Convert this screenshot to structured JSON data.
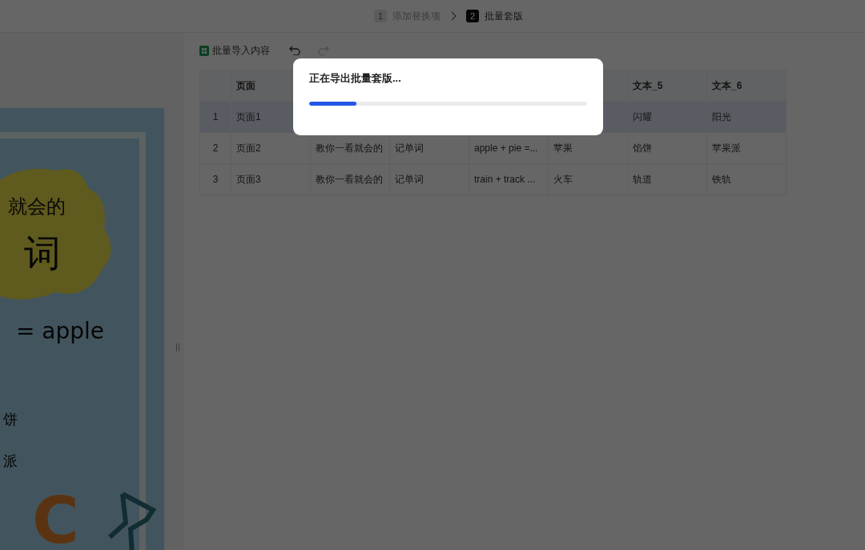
{
  "steps": [
    {
      "number": "1",
      "label": "添加替换项",
      "selected": false
    },
    {
      "number": "2",
      "label": "批量套版",
      "selected": true
    }
  ],
  "preview": {
    "texts": [
      {
        "kind": "subtitle",
        "text": "就会的"
      },
      {
        "kind": "title",
        "text": "词"
      },
      {
        "kind": "formula",
        "text": "= apple"
      },
      {
        "kind": "item",
        "text": "饼"
      },
      {
        "kind": "item",
        "text": "派"
      },
      {
        "kind": "letters",
        "text": "C"
      }
    ]
  },
  "toolbar": {
    "import_button": "批量导入内容",
    "history_buttons": [
      {
        "kind": "undo",
        "disabled": false
      },
      {
        "kind": "redo",
        "disabled": true
      }
    ]
  },
  "table": {
    "columns": [
      "页面",
      null,
      null,
      null,
      null,
      "文本_5",
      "文本_6"
    ],
    "rows": [
      {
        "index": "1",
        "selected": true,
        "cells": [
          "页面1",
          null,
          null,
          null,
          null,
          "闪耀",
          "阳光"
        ]
      },
      {
        "index": "2",
        "selected": false,
        "cells": [
          "页面2",
          "教你一看就会的",
          "记单词",
          "apple + pie =...",
          "苹果",
          "馅饼",
          "苹果派"
        ]
      },
      {
        "index": "3",
        "selected": false,
        "cells": [
          "页面3",
          "教你一看就会的",
          "记单词",
          "train + track ...",
          "火车",
          "轨道",
          "铁轨"
        ]
      }
    ]
  },
  "dialog": {
    "title": "正在导出批量套版...",
    "progress": {
      "level": 0.17
    }
  }
}
